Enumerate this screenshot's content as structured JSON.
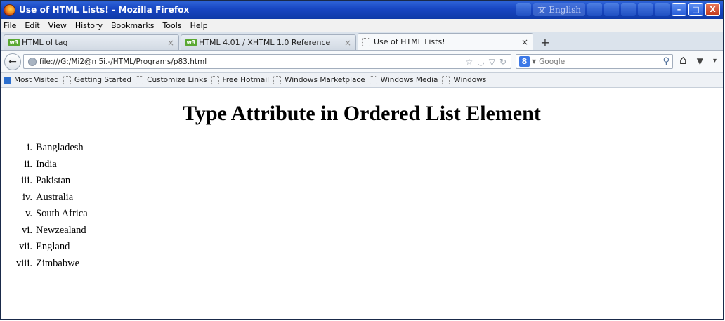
{
  "window": {
    "title": "Use of HTML Lists! - Mozilla Firefox",
    "lang": "English",
    "controls": {
      "minimize": "–",
      "maximize": "□",
      "close": "X"
    }
  },
  "menu": [
    "File",
    "Edit",
    "View",
    "History",
    "Bookmarks",
    "Tools",
    "Help"
  ],
  "tabs": [
    {
      "label": "HTML ol tag",
      "icon": "w3schools-icon"
    },
    {
      "label": "HTML 4.01 / XHTML 1.0 Reference",
      "icon": "w3schools-icon"
    },
    {
      "label": "Use of HTML Lists!",
      "icon": "page-icon",
      "active": true
    }
  ],
  "w3_icon_text": "w3",
  "new_tab": "+",
  "close_glyph": "×",
  "nav": {
    "back": "←",
    "url": "file:///G:/Mi2@n 5i.-/HTML/Programs/p83.html",
    "search_placeholder": "Google",
    "search_engine_glyph": "8"
  },
  "bookmarks": [
    "Most Visited",
    "Getting Started",
    "Customize Links",
    "Free Hotmail",
    "Windows Marketplace",
    "Windows Media",
    "Windows"
  ],
  "content": {
    "heading": "Type Attribute in Ordered List Element",
    "numerals": [
      "i.",
      "ii.",
      "iii.",
      "iv.",
      "v.",
      "vi.",
      "vii.",
      "viii."
    ],
    "items": [
      "Bangladesh",
      "India",
      "Pakistan",
      "Australia",
      "South Africa",
      "Newzealand",
      "England",
      "Zimbabwe"
    ]
  }
}
